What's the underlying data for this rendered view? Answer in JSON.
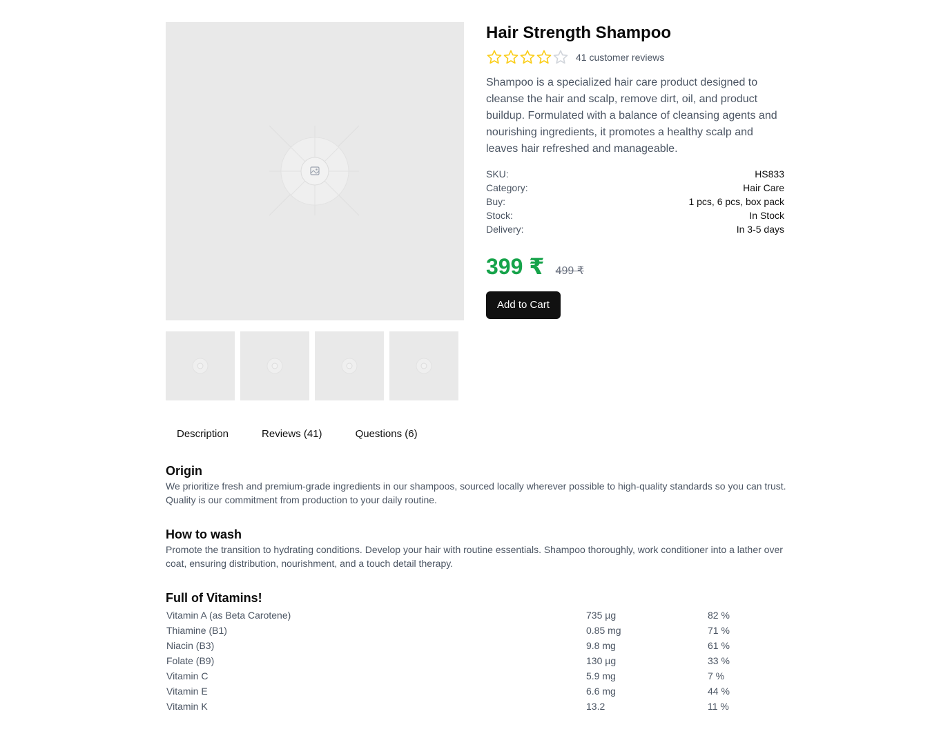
{
  "product": {
    "title": "Hair Strength Shampoo",
    "rating": 4,
    "rating_max": 5,
    "reviews_label": "41 customer reviews",
    "description": "Shampoo is a specialized hair care product designed to cleanse the hair and scalp, remove dirt, oil, and product buildup. Formulated with a balance of cleansing agents and nourishing ingredients, it promotes a healthy scalp and leaves hair refreshed and manageable.",
    "specs": [
      {
        "label": "SKU:",
        "value": "HS833"
      },
      {
        "label": "Category:",
        "value": "Hair Care"
      },
      {
        "label": "Buy:",
        "value": "1 pcs, 6 pcs, box pack"
      },
      {
        "label": "Stock:",
        "value": "In Stock"
      },
      {
        "label": "Delivery:",
        "value": "In 3-5 days"
      }
    ],
    "price": "399 ₹",
    "old_price": "499 ₹",
    "add_to_cart_label": "Add to Cart",
    "image_icon": "image-placeholder-icon",
    "thumbnail_count": 4
  },
  "colors": {
    "price": "#16a34a",
    "star": "#facc15",
    "star_empty": "#d1d5db",
    "button": "#111111"
  },
  "tabs": [
    {
      "label": "Description"
    },
    {
      "label": "Reviews (41)"
    },
    {
      "label": "Questions (6)"
    }
  ],
  "sections": {
    "origin": {
      "heading": "Origin",
      "text": "We prioritize fresh and premium-grade ingredients in our shampoos, sourced locally wherever possible to high-quality standards so you can trust. Quality is our commitment from production to your daily routine."
    },
    "how_to_wash": {
      "heading": "How to wash",
      "text": "Promote the transition to hydrating conditions. Develop your hair with routine essentials. Shampoo thoroughly, work conditioner into a lather over coat, ensuring distribution, nourishment, and a touch detail therapy."
    },
    "vitamins": {
      "heading": "Full of Vitamins!",
      "rows": [
        {
          "name": "Vitamin A (as Beta Carotene)",
          "amount": "735 µg",
          "dv": "82 %"
        },
        {
          "name": "Thiamine (B1)",
          "amount": "0.85 mg",
          "dv": "71 %"
        },
        {
          "name": "Niacin (B3)",
          "amount": "9.8 mg",
          "dv": "61 %"
        },
        {
          "name": "Folate (B9)",
          "amount": "130 µg",
          "dv": "33 %"
        },
        {
          "name": "Vitamin C",
          "amount": "5.9 mg",
          "dv": "7 %"
        },
        {
          "name": "Vitamin E",
          "amount": "6.6 mg",
          "dv": "44 %"
        },
        {
          "name": "Vitamin K",
          "amount": "13.2",
          "dv": "11 %"
        }
      ]
    }
  }
}
